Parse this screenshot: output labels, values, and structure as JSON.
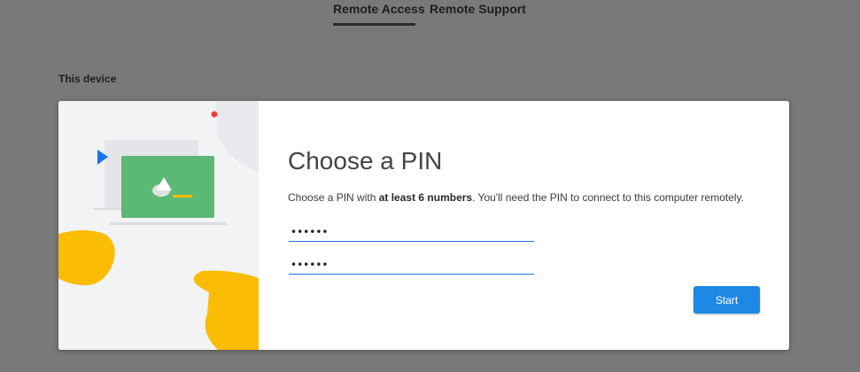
{
  "tabs": [
    {
      "label": "Remote Access",
      "active": true
    },
    {
      "label": "Remote Support",
      "active": false
    }
  ],
  "section": {
    "label": "This device"
  },
  "dialog": {
    "title": "Choose a PIN",
    "description_prefix": "Choose a PIN with ",
    "description_bold": "at least 6 numbers",
    "description_suffix": ". You'll need the PIN to connect to this computer remotely.",
    "pin_value": "••••••",
    "pin_confirm_value": "••••••",
    "start_label": "Start"
  },
  "colors": {
    "accent": "#1e88e5",
    "illustration_green": "#5bb974",
    "illustration_yellow": "#fbbc04",
    "illustration_red": "#ea4335",
    "illustration_blue": "#1a73e8"
  }
}
